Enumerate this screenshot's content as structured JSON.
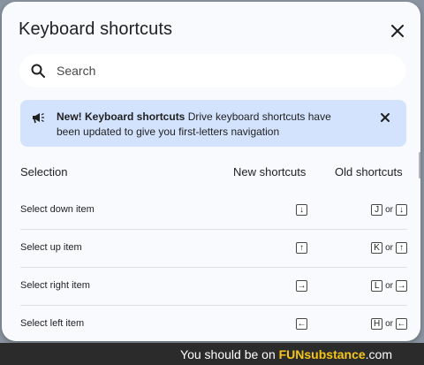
{
  "dialog": {
    "title": "Keyboard shortcuts",
    "close_icon": "close-icon"
  },
  "search": {
    "placeholder": "Search",
    "icon": "search-icon"
  },
  "banner": {
    "icon": "megaphone-icon",
    "bold_text": "New! Keyboard shortcuts",
    "text": " Drive keyboard shortcuts have been updated to give you first-letters navigation",
    "close_icon": "close-icon"
  },
  "table": {
    "headers": {
      "selection": "Selection",
      "new": "New shortcuts",
      "old": "Old shortcuts"
    },
    "or_text": "or",
    "rows": [
      {
        "label": "Select down item",
        "new_key": "↓",
        "old_key": "J",
        "old_alt": "↓"
      },
      {
        "label": "Select up item",
        "new_key": "↑",
        "old_key": "K",
        "old_alt": "↑"
      },
      {
        "label": "Select right item",
        "new_key": "→",
        "old_key": "L",
        "old_alt": "→"
      },
      {
        "label": "Select left item",
        "new_key": "←",
        "old_key": "H",
        "old_alt": "←"
      }
    ]
  },
  "footer": {
    "prefix": "You should be on ",
    "brand": "FUNsubstance",
    "suffix": ".com"
  },
  "colors": {
    "dialog_bg": "#f8fafd",
    "banner_bg": "#d3e3fd",
    "brand_yellow": "#f5c518"
  }
}
